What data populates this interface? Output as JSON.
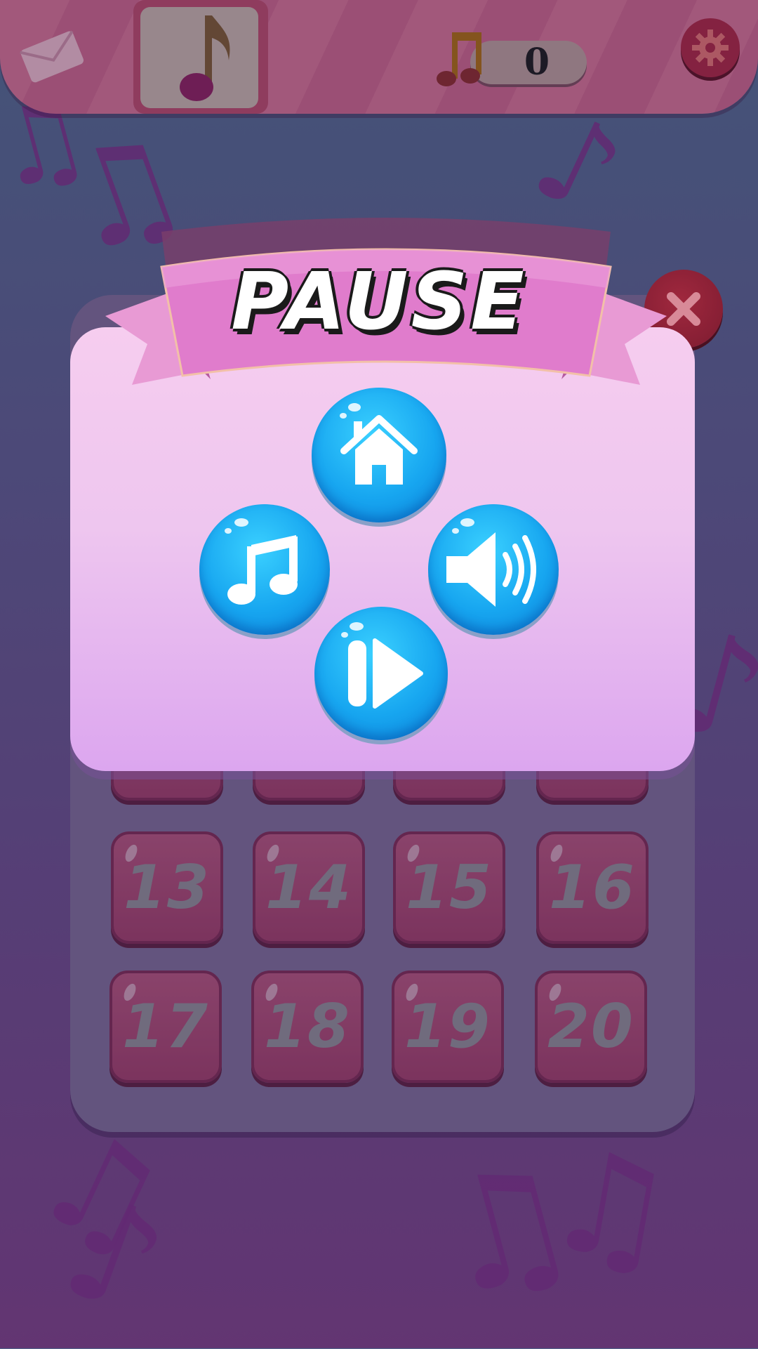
{
  "colors": {
    "accent_pink": "#d875c6",
    "bubble_blue": "#17a6f0",
    "level_tile": "#a5456f",
    "close_red": "#8a1f36"
  },
  "top_bar": {
    "mail_icon": "envelope-icon",
    "current_song_icon": "music-note-icon",
    "notes_icon": "double-music-note-icon",
    "notes_count": "0",
    "settings_icon": "gear-icon"
  },
  "pause_popup": {
    "title": "PAUSE",
    "close_icon": "x-icon",
    "buttons": [
      {
        "name": "home",
        "icon": "home-icon"
      },
      {
        "name": "music",
        "icon": "music-note-icon"
      },
      {
        "name": "sound",
        "icon": "speaker-icon"
      },
      {
        "name": "resume",
        "icon": "play-icon"
      }
    ]
  },
  "levels": {
    "row_1": [
      "13",
      "14",
      "15",
      "16"
    ],
    "row_2": [
      "17",
      "18",
      "19",
      "20"
    ]
  }
}
